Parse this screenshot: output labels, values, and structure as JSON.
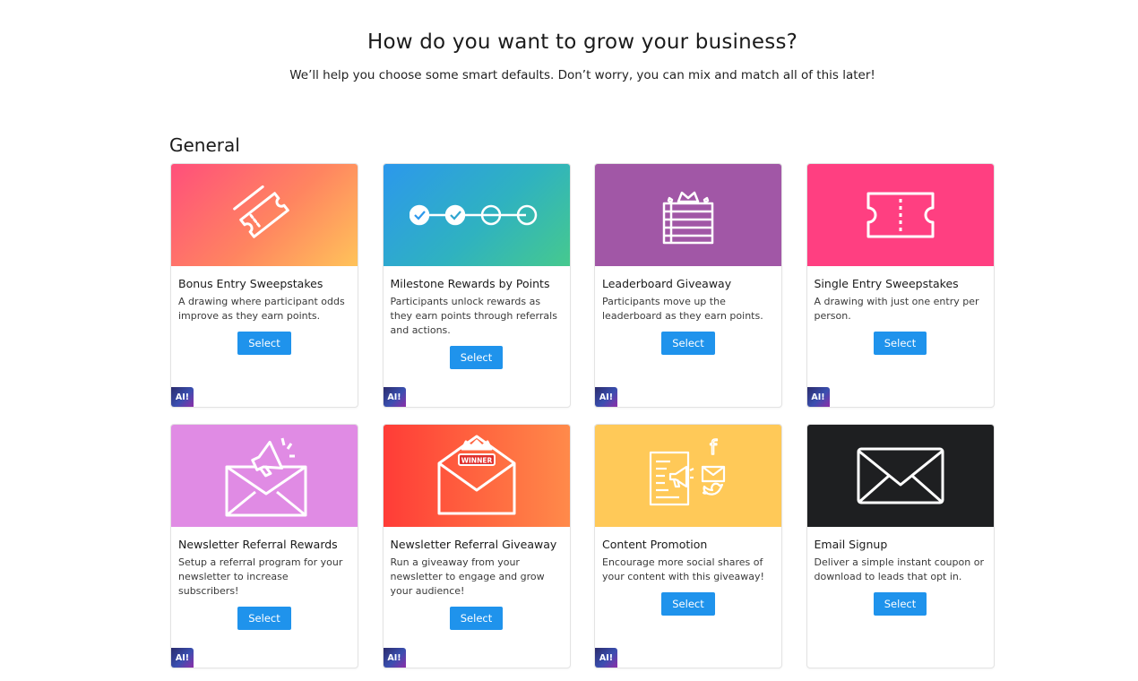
{
  "header": {
    "title": "How do you want to grow your business?",
    "subtitle": "We’ll help you choose some smart defaults. Don’t worry, you can mix and match all of this later!"
  },
  "section": {
    "title": "General"
  },
  "badge_label": "AI!",
  "cards": [
    {
      "title": "Bonus Entry Sweepstakes",
      "description": "A drawing where participant odds improve as they earn points.",
      "button": "Select",
      "icon": "tickets-icon"
    },
    {
      "title": "Milestone Rewards by Points",
      "description": "Participants unlock rewards as they earn points through referrals and actions.",
      "button": "Select",
      "icon": "milestone-steps-icon"
    },
    {
      "title": "Leaderboard Giveaway",
      "description": "Participants move up the leaderboard as they earn points.",
      "button": "Select",
      "icon": "leaderboard-crown-icon"
    },
    {
      "title": "Single Entry Sweepstakes",
      "description": "A drawing with just one entry per person.",
      "button": "Select",
      "icon": "ticket-icon"
    },
    {
      "title": "Newsletter Referral Rewards",
      "description": "Setup a referral program for your newsletter to increase subscribers!",
      "button": "Select",
      "icon": "envelope-megaphone-icon"
    },
    {
      "title": "Newsletter Referral Giveaway",
      "description": "Run a giveaway from your newsletter to engage and grow your audience!",
      "button": "Select",
      "icon": "envelope-winner-icon",
      "winner_label": "WINNER"
    },
    {
      "title": "Content Promotion",
      "description": "Encourage more social shares of your content with this giveaway!",
      "button": "Select",
      "icon": "content-social-icon",
      "facebook_letter": "f"
    },
    {
      "title": "Email Signup",
      "description": "Deliver a simple instant coupon or download to leads that opt in.",
      "button": "Select",
      "icon": "envelope-icon"
    }
  ],
  "colors": {
    "button": "#1f93ec",
    "leaderboard": "#a157a6",
    "single_entry": "#ff3f81",
    "newsletter_rewards": "#e08be4",
    "content_promotion": "#ffc958",
    "email_signup": "#1e1f21"
  }
}
